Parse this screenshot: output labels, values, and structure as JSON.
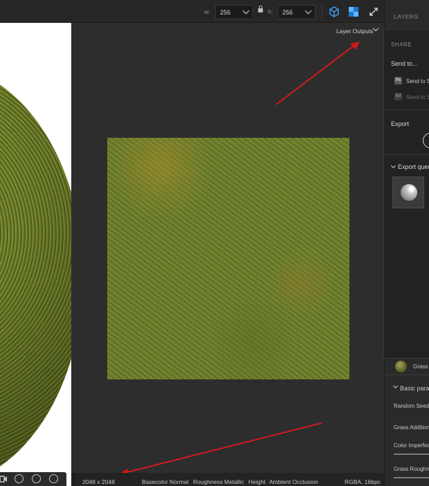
{
  "toolbar": {
    "width_label": "w:",
    "width_value": "256",
    "height_label": "h:",
    "height_value": "256",
    "icons": [
      "cube-view-icon",
      "checker-view-icon",
      "expand-icon"
    ]
  },
  "viewport3d": {
    "tools": [
      "camera-icon",
      "orbit-icon",
      "globe-icon",
      "environment-icon"
    ]
  },
  "view2d": {
    "layer_outputs_label": "Layer Outputs"
  },
  "statusbar": {
    "resolution": "2048 x 2048",
    "channels": [
      "Basecolor",
      "Normal",
      "Roughness",
      "Metallic",
      "Height",
      "Ambient Occlusion"
    ],
    "format": "RGBA, 16bpc"
  },
  "panel": {
    "header": "LAYERS",
    "share": {
      "title": "SHARE",
      "send_to": "Send to...",
      "send_ps": "Send to S",
      "send_sd": "Send to S",
      "ps_badge": "Ps",
      "sd_badge": "Sd",
      "export": "Export",
      "export_queue": "Export queu"
    },
    "layer_name": "Grass C",
    "basic_params": "Basic param",
    "params": [
      "Random Seed",
      "Grass Additional",
      "Color Imperfect",
      "Grass Roughnes"
    ]
  }
}
